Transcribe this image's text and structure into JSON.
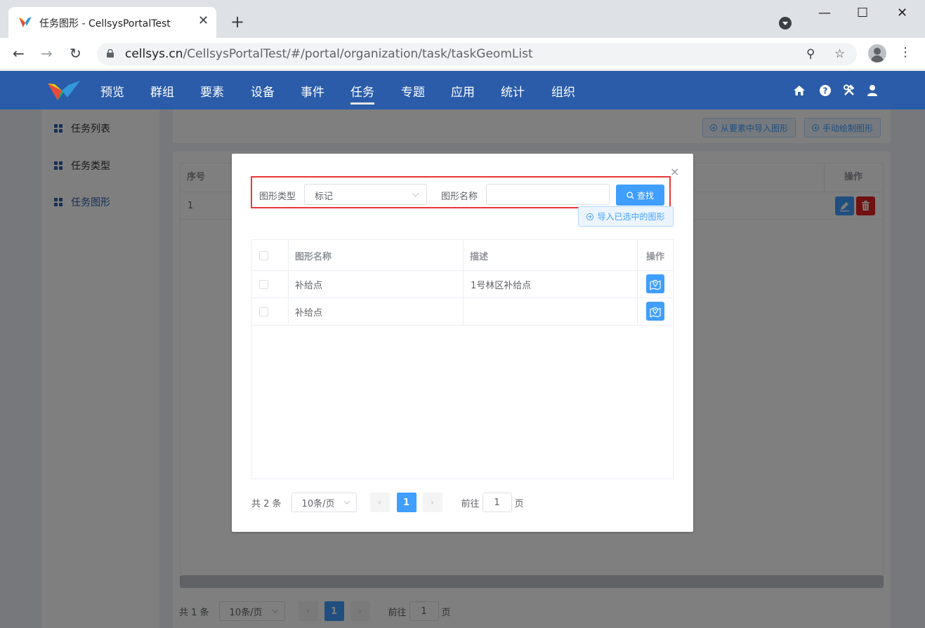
{
  "browser": {
    "tab_title": "任务图形 - CellsysPortalTest",
    "tab_close": "✕",
    "new_tab": "+",
    "url_host": "cellsys.cn",
    "url_path": "/CellsysPortalTest/#/portal/organization/task/taskGeomList",
    "back": "←",
    "forward": "→",
    "reload": "↻",
    "zoom_icon": "⚲",
    "star_icon": "☆",
    "menu": "⋮",
    "minimize": "—",
    "maximize": "☐",
    "close": "✕"
  },
  "app_nav": {
    "items": [
      "预览",
      "群组",
      "要素",
      "设备",
      "事件",
      "任务",
      "专题",
      "应用",
      "统计",
      "组织"
    ],
    "active_index": 5
  },
  "sidebar": {
    "items": [
      {
        "label": "任务列表",
        "active": false
      },
      {
        "label": "任务类型",
        "active": false
      },
      {
        "label": "任务图形",
        "active": true
      }
    ]
  },
  "toolbar": {
    "import_from_features": "从要素中导入图形",
    "manual_draw": "手动绘制图形"
  },
  "bg_table": {
    "columns": [
      "序号",
      "操作"
    ],
    "rows": [
      {
        "index": "1"
      }
    ]
  },
  "bg_pager": {
    "total": "共 1 条",
    "page_size": "10条/页",
    "current_page": "1",
    "goto_prefix": "前往",
    "goto_value": "1",
    "goto_suffix": "页"
  },
  "dialog": {
    "close": "×",
    "type_label": "图形类型",
    "type_value": "标记",
    "name_label": "图形名称",
    "name_value": "",
    "search_label": "查找",
    "import_selected": "导入已选中的图形",
    "columns": [
      "图形名称",
      "描述",
      "操作"
    ],
    "rows": [
      {
        "name": "补给点",
        "desc": "1号林区补给点"
      },
      {
        "name": "补给点",
        "desc": ""
      }
    ],
    "pager": {
      "total": "共 2 条",
      "page_size": "10条/页",
      "current_page": "1",
      "goto_prefix": "前往",
      "goto_value": "1",
      "goto_suffix": "页"
    }
  },
  "colors": {
    "app_header": "#2a5caa",
    "primary": "#409eff",
    "danger": "#e02020",
    "highlight": "#e53935"
  }
}
